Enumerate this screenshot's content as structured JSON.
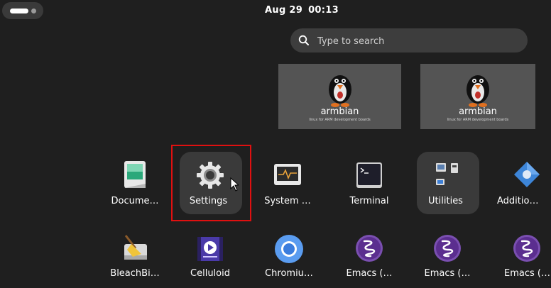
{
  "topbar": {
    "date": "Aug 29",
    "time": "00:13"
  },
  "search": {
    "placeholder": "Type to search"
  },
  "workspaces": [
    {
      "brand": "armbian",
      "subtitle": "linux for ARM development boards"
    },
    {
      "brand": "armbian",
      "subtitle": "linux for ARM development boards"
    }
  ],
  "apps_row1": [
    {
      "label": "Docume…",
      "icon": "document-viewer-icon"
    },
    {
      "label": "Settings",
      "icon": "gear-icon"
    },
    {
      "label": "System …",
      "icon": "system-monitor-icon"
    },
    {
      "label": "Terminal",
      "icon": "terminal-icon"
    },
    {
      "label": "Utilities",
      "icon": "utilities-folder-icon"
    },
    {
      "label": "Additio…",
      "icon": "software-icon"
    }
  ],
  "apps_row2": [
    {
      "label": "BleachBi…",
      "icon": "bleachbit-broom-icon"
    },
    {
      "label": "Celluloid",
      "icon": "celluloid-video-icon"
    },
    {
      "label": "Chromiu…",
      "icon": "chromium-icon"
    },
    {
      "label": "Emacs (…",
      "icon": "emacs-icon"
    },
    {
      "label": "Emacs (…",
      "icon": "emacs-icon"
    },
    {
      "label": "Emacs (…",
      "icon": "emacs-icon"
    }
  ],
  "colors": {
    "background": "#1f1f1f",
    "highlight": "#e01010",
    "tile": "#3a3a3a"
  }
}
